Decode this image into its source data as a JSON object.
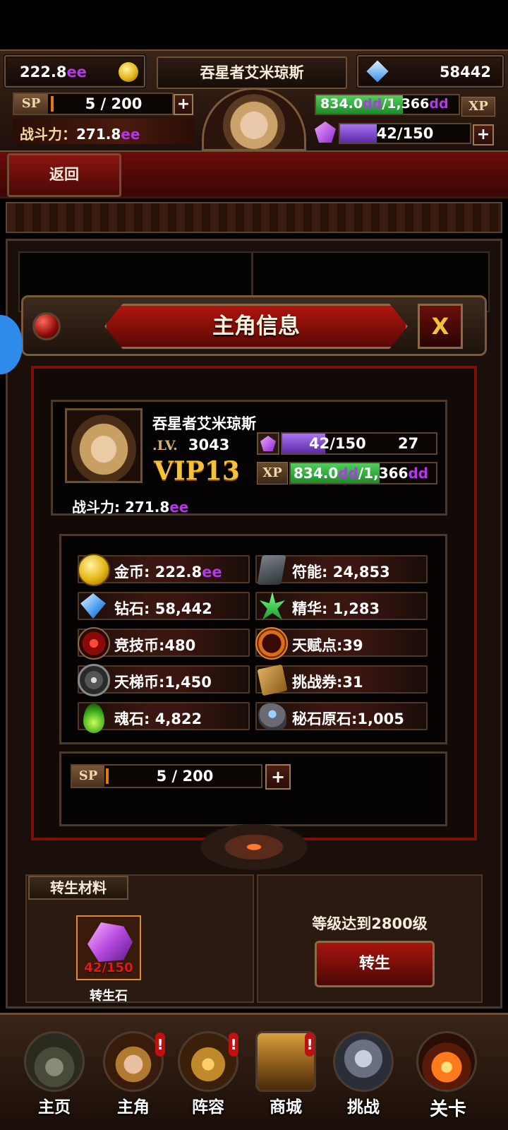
{
  "topbar": {
    "gold": {
      "value": "222.8",
      "suffix": "ee"
    },
    "hero_name": "吞星者艾米琼斯",
    "diamonds": "58442",
    "sp": {
      "label": "SP",
      "value": "5 / 200",
      "fraction": 0.025
    },
    "power": {
      "label": "战斗力：",
      "value": "271.8",
      "suffix": "ee"
    },
    "xp": {
      "label": "XP",
      "current": "834.0",
      "current_suffix": "dd",
      "sep": "/1,366",
      "max_suffix": "dd",
      "fraction": 0.61
    },
    "gems": {
      "value": "42/150",
      "fraction": 0.28
    },
    "plus": "+"
  },
  "back_button": "返回",
  "dialog": {
    "title": "主角信息",
    "close": "X",
    "profile": {
      "name": "吞星者艾米琼斯",
      "lv_label": ".LV.",
      "level": "3043",
      "vip": "VIP13",
      "gem_bar": {
        "value": "42/150",
        "extra": "27",
        "fraction": 0.28
      },
      "xp_bar": {
        "label": "XP",
        "current": "834.0",
        "current_suffix": "dd",
        "sep": "/1,366",
        "max_suffix": "dd",
        "fraction": 0.61
      },
      "power_label": "战斗力: ",
      "power_value": "271.8",
      "power_suffix": "ee"
    },
    "resources": [
      {
        "icon": "gold-coin-icon",
        "label": "金币: 222.8",
        "suffix": "ee"
      },
      {
        "icon": "rune-icon",
        "label": "符能: 24,853",
        "suffix": ""
      },
      {
        "icon": "diamond-icon",
        "label": "钻石: 58,442",
        "suffix": ""
      },
      {
        "icon": "essence-icon",
        "label": "精华: 1,283",
        "suffix": ""
      },
      {
        "icon": "arena-coin-icon",
        "label": "竞技币:480",
        "suffix": ""
      },
      {
        "icon": "talent-icon",
        "label": "天赋点:39",
        "suffix": ""
      },
      {
        "icon": "ladder-coin-icon",
        "label": "天梯币:1,450",
        "suffix": ""
      },
      {
        "icon": "challenge-ticket-icon",
        "label": "挑战券:31",
        "suffix": ""
      },
      {
        "icon": "soul-stone-icon",
        "label": "魂石: 4,822",
        "suffix": ""
      },
      {
        "icon": "secret-ore-icon",
        "label": "秘石原石:1,005",
        "suffix": ""
      }
    ],
    "sp": {
      "label": "SP",
      "value": "5 / 200",
      "fraction": 0.025
    }
  },
  "rebirth": {
    "section_title": "转生材料",
    "material_count": "42/150",
    "material_name": "转生石",
    "requirement": "等级达到2800级",
    "button": "转生"
  },
  "nav": [
    {
      "label": "主页",
      "icon": "home-castle-icon",
      "badge": ""
    },
    {
      "label": "主角",
      "icon": "hero-portrait-icon",
      "badge": "!"
    },
    {
      "label": "阵容",
      "icon": "lineup-helmet-icon",
      "badge": "!"
    },
    {
      "label": "商城",
      "icon": "shop-chest-icon",
      "badge": "!"
    },
    {
      "label": "挑战",
      "icon": "challenge-axes-icon",
      "badge": ""
    },
    {
      "label": "关卡",
      "icon": "stage-flame-icon",
      "badge": ""
    }
  ],
  "colors": {
    "accent_purple": "#b238e8",
    "xp_green": "#2db33a",
    "gem_purple": "#8a3cd8",
    "gold_text": "#f3c23a",
    "frame_red": "#7a0f0b"
  }
}
